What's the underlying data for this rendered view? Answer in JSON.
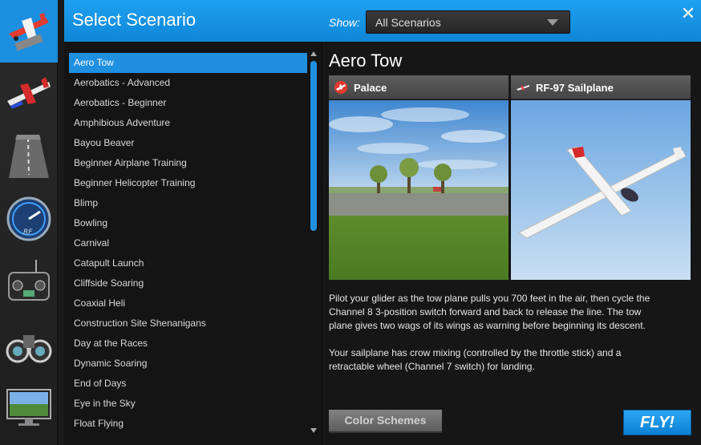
{
  "header": {
    "title": "Select Scenario",
    "show_label": "Show:",
    "show_value": "All Scenarios",
    "close_symbol": "✕"
  },
  "rail": {
    "items": [
      {
        "icon": "scenario-airplane-icon",
        "active": true
      },
      {
        "icon": "aircraft-icon",
        "active": false
      },
      {
        "icon": "runway-icon",
        "active": false
      },
      {
        "icon": "gauge-icon",
        "active": false
      },
      {
        "icon": "transmitter-icon",
        "active": false
      },
      {
        "icon": "binoculars-icon",
        "active": false
      },
      {
        "icon": "monitor-icon",
        "active": false
      }
    ]
  },
  "scenarios": {
    "selected": "Aero Tow",
    "items": [
      "Aero Tow",
      "Aerobatics - Advanced",
      "Aerobatics - Beginner",
      "Amphibious Adventure",
      "Bayou Beaver",
      "Beginner Airplane Training",
      "Beginner Helicopter Training",
      "Blimp",
      "Bowling",
      "Carnival",
      "Catapult Launch",
      "Cliffside Soaring",
      "Coaxial Heli",
      "Construction Site Shenanigans",
      "Day at the Races",
      "Dynamic Soaring",
      "End of Days",
      "Eye in the Sky",
      "Float Flying"
    ]
  },
  "detail": {
    "title": "Aero Tow",
    "site_label": "Palace",
    "plane_label": "RF-97 Sailplane",
    "description": [
      "Pilot your glider as the tow plane pulls you 700 feet in the air, then cycle the\nChannel 8 3-position switch forward and back to release the line.  The tow\nplane gives two wags of its wings as warning before beginning its descent.",
      "Your sailplane has crow mixing (controlled by the throttle stick) and a\nretractable wheel (Channel 7 switch) for landing."
    ],
    "color_schemes_label": "Color Schemes",
    "fly_label": "FLY!"
  },
  "colors": {
    "accent": "#1f8fe0",
    "header": "#1a96e8"
  }
}
